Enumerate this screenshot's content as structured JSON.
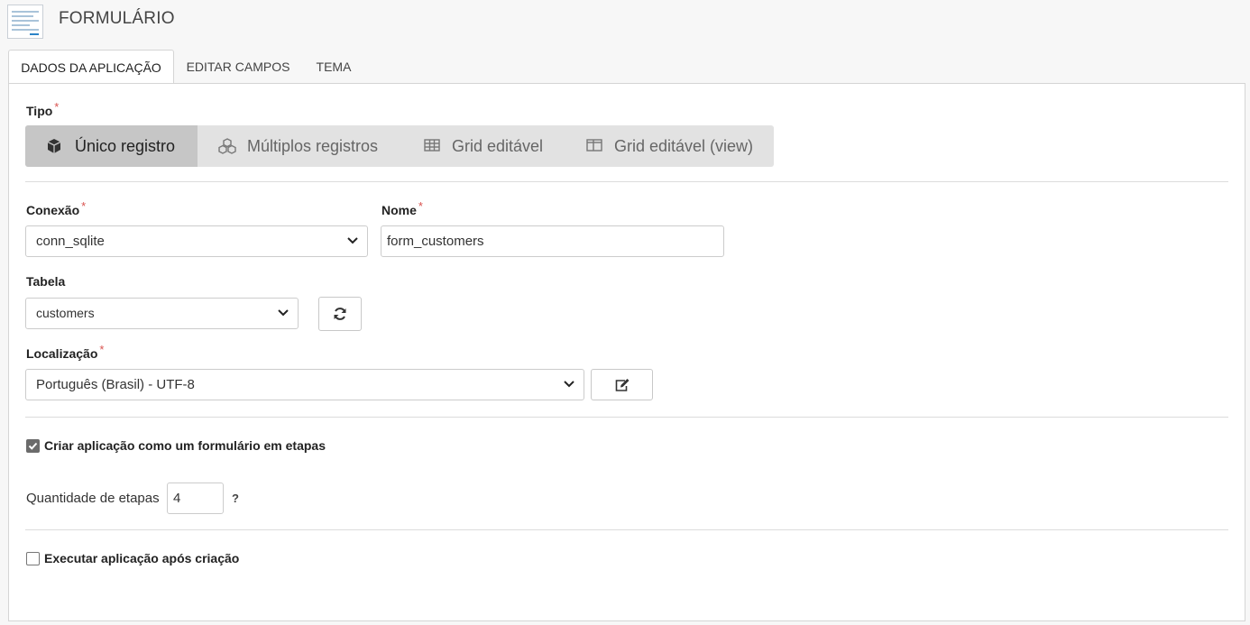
{
  "header": {
    "title": "FORMULÁRIO",
    "icon": "form-document-icon"
  },
  "tabs": [
    {
      "label": "DADOS DA APLICAÇÃO",
      "active": true
    },
    {
      "label": "EDITAR CAMPOS",
      "active": false
    },
    {
      "label": "TEMA",
      "active": false
    }
  ],
  "tipo": {
    "label": "Tipo",
    "options": [
      {
        "label": "Único registro",
        "icon": "cube-icon",
        "selected": true
      },
      {
        "label": "Múltiplos registros",
        "icon": "cubes-icon",
        "selected": false
      },
      {
        "label": "Grid editável",
        "icon": "table-icon",
        "selected": false
      },
      {
        "label": "Grid editável (view)",
        "icon": "columns-icon",
        "selected": false
      }
    ]
  },
  "conexao": {
    "label": "Conexão",
    "value": "conn_sqlite"
  },
  "nome": {
    "label": "Nome",
    "value": "form_customers"
  },
  "tabela": {
    "label": "Tabela",
    "value": "customers",
    "refresh_icon": "refresh-icon"
  },
  "localizacao": {
    "label": "Localização",
    "value": "Português (Brasil) - UTF-8",
    "edit_icon": "edit-icon"
  },
  "steps": {
    "checkbox_label": "Criar aplicação como um formulário em etapas",
    "checked": true,
    "quantity_label": "Quantidade de etapas",
    "quantity_value": "4",
    "help": "?"
  },
  "run_after": {
    "checkbox_label": "Executar aplicação após criação",
    "checked": false
  },
  "required_mark": "*",
  "colors": {
    "required": "#d9534f",
    "segment_active": "#c6c6c6",
    "segment_bg": "#e2e2e2"
  }
}
